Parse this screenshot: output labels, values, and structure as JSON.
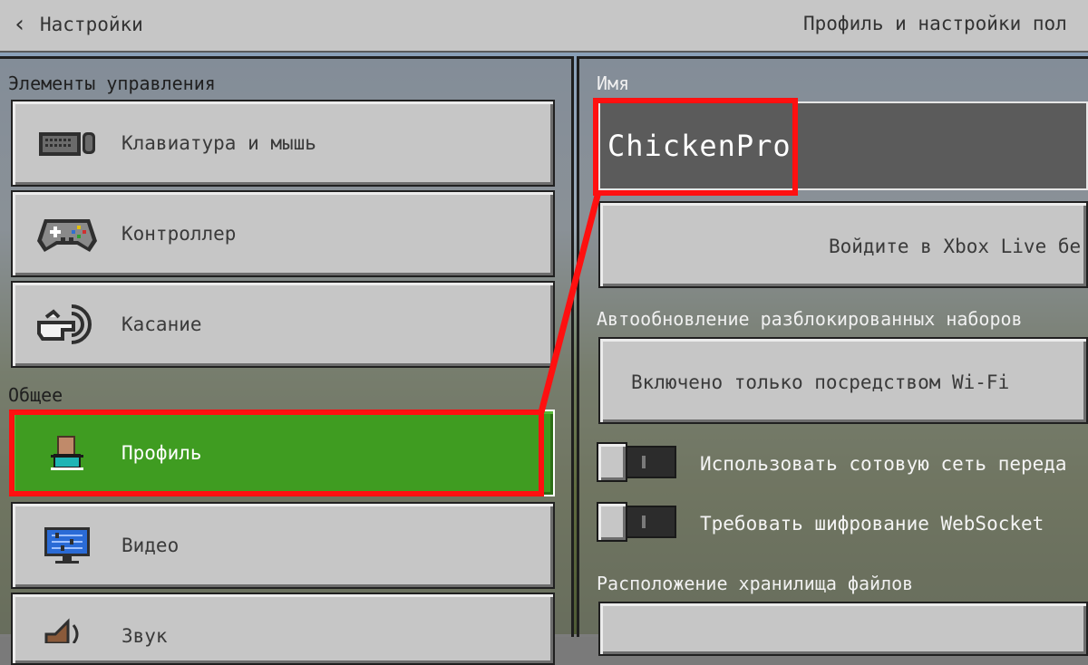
{
  "header": {
    "back_label": "Настройки",
    "right_title": "Профиль и настройки пол"
  },
  "left": {
    "section_controls": "Элементы управления",
    "section_general": "Общее",
    "items": [
      {
        "label": "Клавиатура и мышь",
        "icon": "keyboard-mouse-icon"
      },
      {
        "label": "Контроллер",
        "icon": "gamepad-icon"
      },
      {
        "label": "Касание",
        "icon": "touch-hand-icon"
      },
      {
        "label": "Профиль",
        "icon": "profile-icon",
        "active": true
      },
      {
        "label": "Видео",
        "icon": "monitor-icon"
      },
      {
        "label": "Звук",
        "icon": "speaker-icon"
      }
    ]
  },
  "right": {
    "name_label": "Имя",
    "name_value": "ChickenPro",
    "xbox_button": "Войдите в Xbox Live бе",
    "autoupdate_label": "Автообновление разблокированных наборов",
    "autoupdate_value": "Включено только посредством Wi-Fi",
    "toggle_cellular": "Использовать сотовую сеть переда",
    "toggle_websocket": "Требовать шифрование WebSocket",
    "storage_label": "Расположение хранилища файлов"
  },
  "colors": {
    "active_green": "#3f9c21",
    "highlight_red": "#ff1010",
    "button_gray": "#c6c6c6"
  }
}
